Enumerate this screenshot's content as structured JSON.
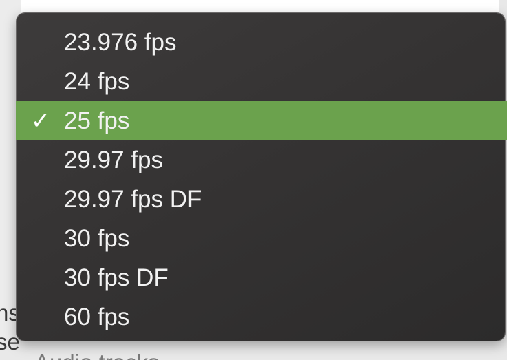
{
  "menu": {
    "selected_index": 2,
    "selected_color": "#6ba24d",
    "items": [
      {
        "label": "23.976 fps",
        "checked": false
      },
      {
        "label": "24 fps",
        "checked": false
      },
      {
        "label": "25 fps",
        "checked": true,
        "checkmark": "✓"
      },
      {
        "label": "29.97 fps",
        "checked": false
      },
      {
        "label": "29.97 fps DF",
        "checked": false
      },
      {
        "label": "30 fps",
        "checked": false
      },
      {
        "label": "30 fps DF",
        "checked": false
      },
      {
        "label": "60 fps",
        "checked": false
      }
    ]
  },
  "background": {
    "label_1": "ns",
    "label_2": "se",
    "label_3": "Audio tracks"
  }
}
